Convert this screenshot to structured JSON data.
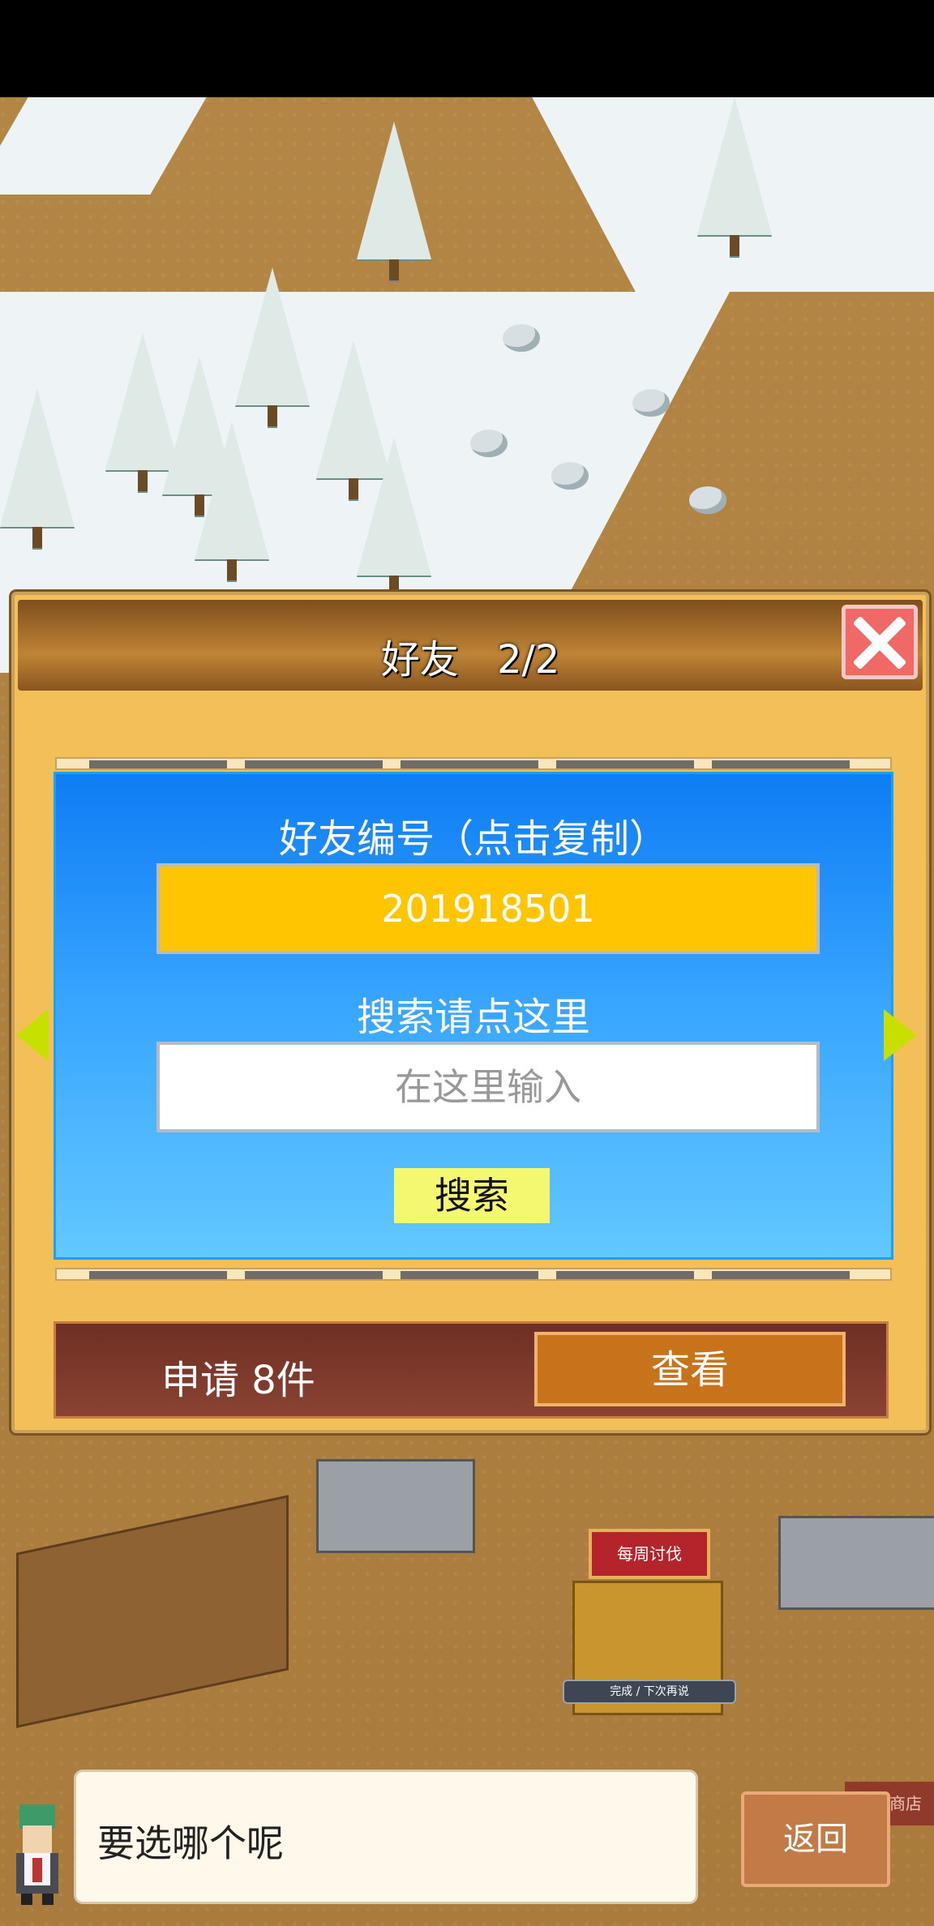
{
  "dialog": {
    "title": "好友",
    "page": "2/2"
  },
  "friend_panel": {
    "id_label": "好友编号（点击复制）",
    "friend_id": "201918501",
    "search_label": "搜索请点这里",
    "search_placeholder": "在这里输入",
    "search_button": "搜索"
  },
  "requests": {
    "label": "申请 8件",
    "view_button": "查看"
  },
  "map": {
    "weekly_badge": "每周讨伐",
    "weekly_note": "完成 / 下次再说",
    "material_shop": "素材商店"
  },
  "bottom": {
    "speech": "要选哪个呢",
    "back_button": "返回"
  },
  "colors": {
    "panel_blue": "#1a8cff",
    "id_box": "#ffc600",
    "search_button": "#f4f871",
    "close_button": "#ef6a66",
    "view_button": "#c6731b"
  }
}
